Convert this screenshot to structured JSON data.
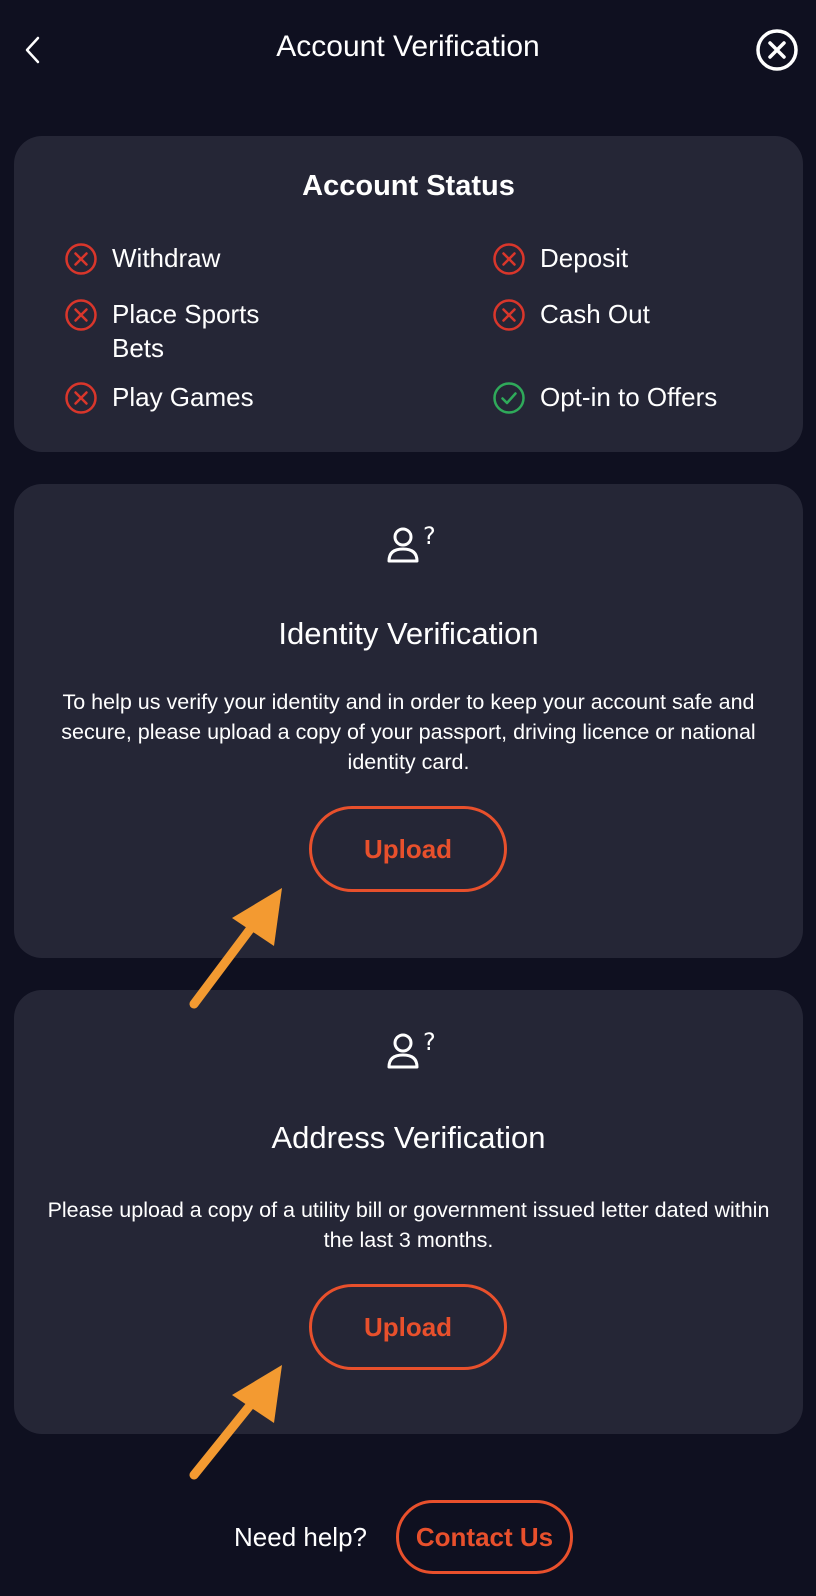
{
  "header": {
    "title": "Account Verification",
    "back_icon": "chevron-left-icon",
    "close_icon": "close-circle-icon"
  },
  "account_status": {
    "title": "Account Status",
    "items": [
      {
        "label": "Withdraw",
        "status": "blocked"
      },
      {
        "label": "Deposit",
        "status": "blocked"
      },
      {
        "label": "Place Sports Bets",
        "status": "blocked"
      },
      {
        "label": "Cash Out",
        "status": "blocked"
      },
      {
        "label": "Play Games",
        "status": "blocked"
      },
      {
        "label": "Opt-in to Offers",
        "status": "allowed"
      }
    ]
  },
  "identity": {
    "icon": "user-question-icon",
    "title": "Identity Verification",
    "description": "To help us verify your identity and in order to keep your account safe and secure, please upload a copy of your passport, driving licence or national identity card.",
    "button_label": "Upload"
  },
  "address": {
    "icon": "user-question-icon",
    "title": "Address Verification",
    "description": "Please upload a copy of a utility bill or government issued letter dated within the last 3 months.",
    "button_label": "Upload"
  },
  "footer": {
    "help_text": "Need help?",
    "contact_label": "Contact Us"
  },
  "colors": {
    "background": "#0f1020",
    "card": "#252636",
    "accent": "#e8502c",
    "blocked": "#d9362b",
    "allowed": "#2faa5a",
    "annotation_arrow": "#f39a31"
  }
}
